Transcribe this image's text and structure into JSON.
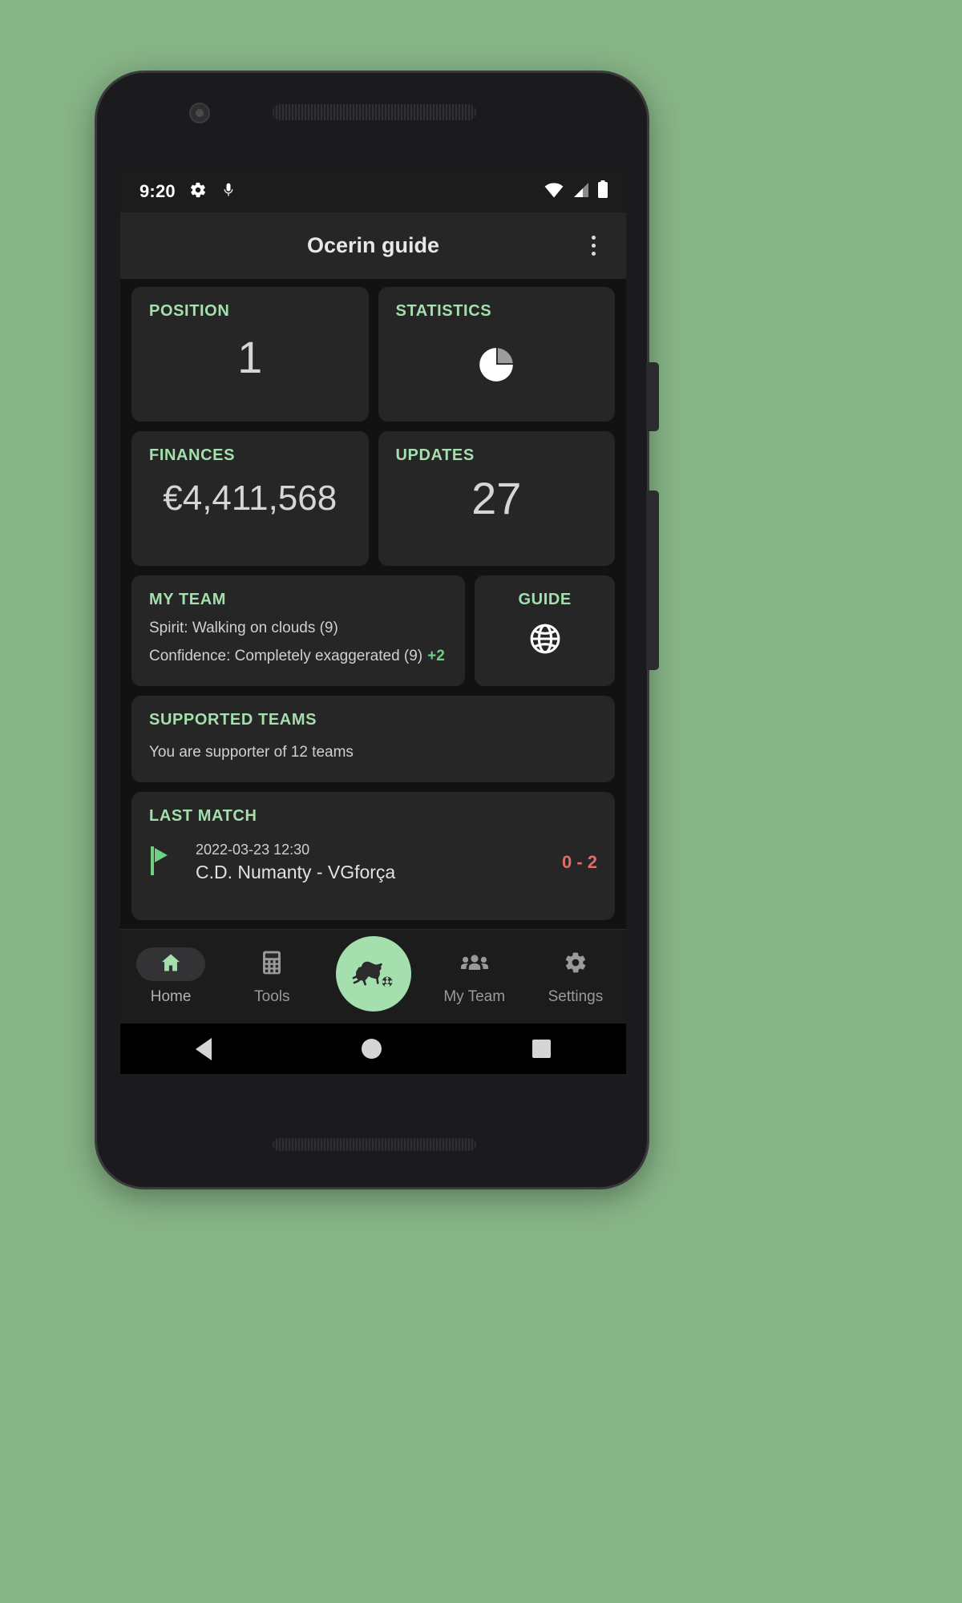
{
  "status_bar": {
    "time": "9:20",
    "left_icons": [
      "gear-icon",
      "microphone-icon"
    ],
    "right_icons": [
      "wifi-icon",
      "cellular-signal-icon",
      "battery-icon"
    ]
  },
  "app_bar": {
    "title": "Ocerin guide",
    "overflow_icon": "more-vertical-icon"
  },
  "theme": {
    "accent_green": "#a5dfae",
    "delta_green": "#6fcf85",
    "score_red": "#e06c6c",
    "card_bg": "#262626",
    "screen_bg": "#121212"
  },
  "cards": {
    "position": {
      "title": "POSITION",
      "value": "1"
    },
    "statistics": {
      "title": "STATISTICS",
      "icon": "pie-chart-icon"
    },
    "finances": {
      "title": "FINANCES",
      "value": "€4,411,568"
    },
    "updates": {
      "title": "UPDATES",
      "value": "27"
    },
    "my_team": {
      "title": "MY TEAM",
      "spirit": "Spirit: Walking on clouds (9)",
      "confidence": "Confidence: Completely exaggerated (9)",
      "confidence_delta": "+2"
    },
    "guide": {
      "title": "GUIDE",
      "icon": "globe-icon"
    },
    "supported_teams": {
      "title": "SUPPORTED TEAMS",
      "text": "You are supporter of 12 teams"
    },
    "last_match": {
      "title": "LAST MATCH",
      "flag_icon": "flag-icon",
      "date": "2022-03-23 12:30",
      "teams": "C.D. Numanty - VGforça",
      "score": "0 - 2"
    }
  },
  "bottom_nav": {
    "items": [
      {
        "label": "Home",
        "icon": "home-icon",
        "active": true
      },
      {
        "label": "Tools",
        "icon": "calculator-icon",
        "active": false
      },
      {
        "label": "My Team",
        "icon": "people-icon",
        "active": false
      },
      {
        "label": "Settings",
        "icon": "gear-icon",
        "active": false
      }
    ],
    "fab": {
      "icon": "panther-with-ball-icon"
    }
  },
  "system_nav": {
    "back": "back-triangle-icon",
    "home": "home-circle-icon",
    "recents": "recents-square-icon"
  }
}
